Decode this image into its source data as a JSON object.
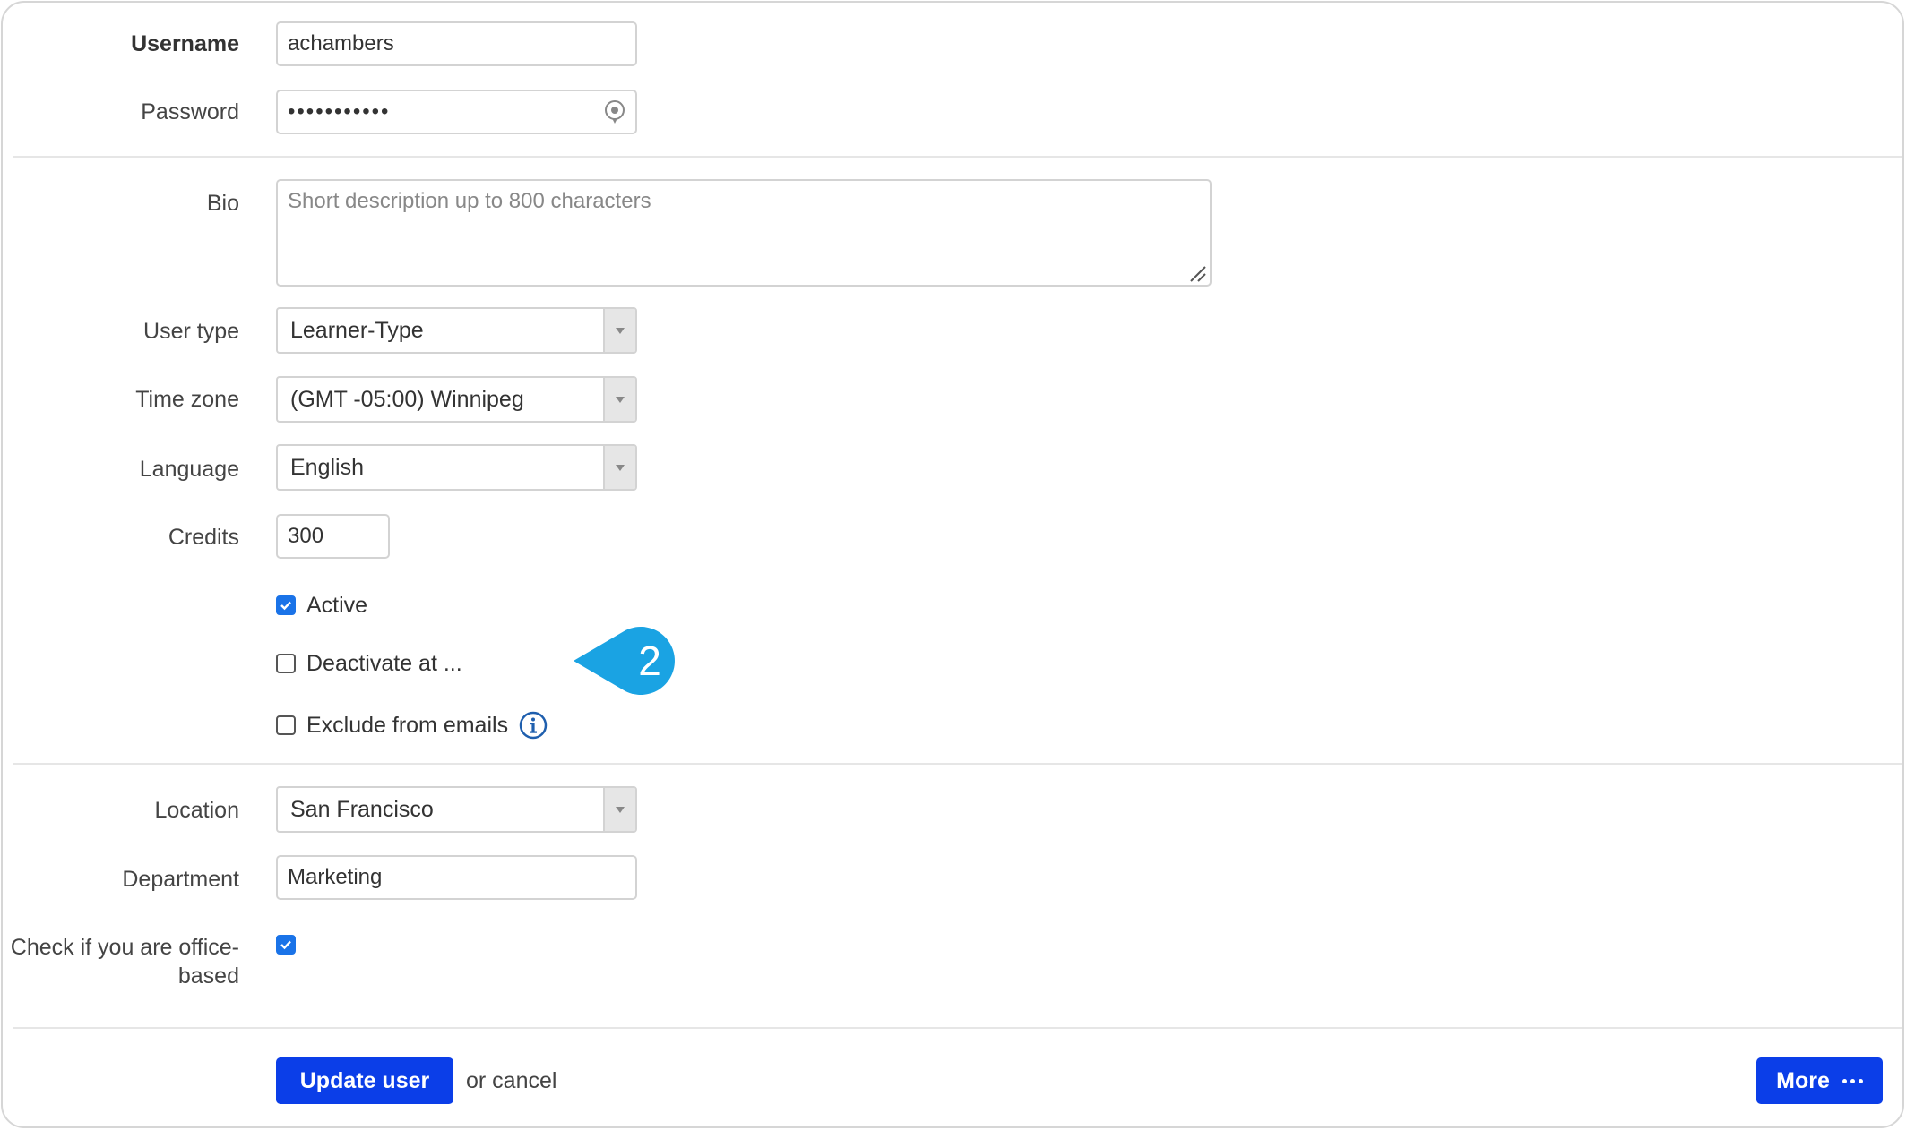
{
  "form": {
    "username": {
      "label": "Username",
      "value": "achambers"
    },
    "password": {
      "label": "Password",
      "masked_value": "•••••••••••"
    },
    "bio": {
      "label": "Bio",
      "placeholder": "Short description up to 800 characters"
    },
    "user_type": {
      "label": "User type",
      "selected": "Learner-Type"
    },
    "time_zone": {
      "label": "Time zone",
      "selected": "(GMT -05:00) Winnipeg"
    },
    "language": {
      "label": "Language",
      "selected": "English"
    },
    "credits": {
      "label": "Credits",
      "value": "300"
    },
    "active": {
      "label": "Active",
      "checked": true
    },
    "deactivate": {
      "label": "Deactivate at ...",
      "checked": false
    },
    "exclude_emails": {
      "label": "Exclude from emails",
      "checked": false
    },
    "location": {
      "label": "Location",
      "selected": "San Francisco"
    },
    "department": {
      "label": "Department",
      "value": "Marketing"
    },
    "office_based": {
      "label": "Check if you are office-based",
      "checked": true
    }
  },
  "callout": {
    "number": "2",
    "color": "#1aa3e3"
  },
  "actions": {
    "update_label": "Update user",
    "cancel_text": "or cancel",
    "more_label": "More"
  },
  "colors": {
    "primary": "#0b3ee8",
    "checkbox": "#1a73e8",
    "info": "#1f5fae"
  }
}
